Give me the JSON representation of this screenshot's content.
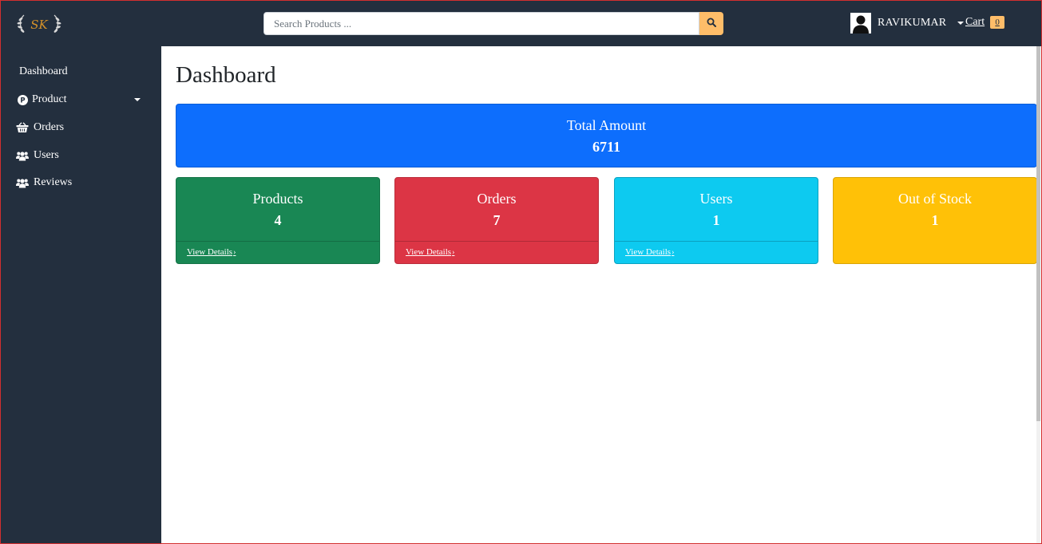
{
  "header": {
    "logo_text": "SK",
    "search": {
      "placeholder": "Search Products ...",
      "value": ""
    },
    "search_button_icon": "search-icon",
    "user": {
      "name": "RAVIKUMAR",
      "avatar_icon": "user-silhouette-icon"
    },
    "cart": {
      "label": "Cart",
      "count": "0"
    }
  },
  "sidebar": {
    "items": [
      {
        "label": "Dashboard",
        "icon": ""
      },
      {
        "label": "Product",
        "icon": "product-p-icon",
        "has_dropdown": true
      },
      {
        "label": "Orders",
        "icon": "basket-icon"
      },
      {
        "label": "Users",
        "icon": "users-icon"
      },
      {
        "label": "Reviews",
        "icon": "users-icon"
      }
    ]
  },
  "main": {
    "title": "Dashboard",
    "total": {
      "label": "Total Amount",
      "value": "6711",
      "color": "#0d6efd"
    },
    "cards": [
      {
        "label": "Products",
        "value": "4",
        "link": "View Details",
        "color": "#198754"
      },
      {
        "label": "Orders",
        "value": "7",
        "link": "View Details",
        "color": "#dc3545"
      },
      {
        "label": "Users",
        "value": "1",
        "link": "View Details",
        "color": "#0dcaf0"
      },
      {
        "label": "Out of Stock",
        "value": "1",
        "color": "#ffc107"
      }
    ]
  },
  "colors": {
    "nav_bg": "#232f3e",
    "accent": "#febd69"
  }
}
